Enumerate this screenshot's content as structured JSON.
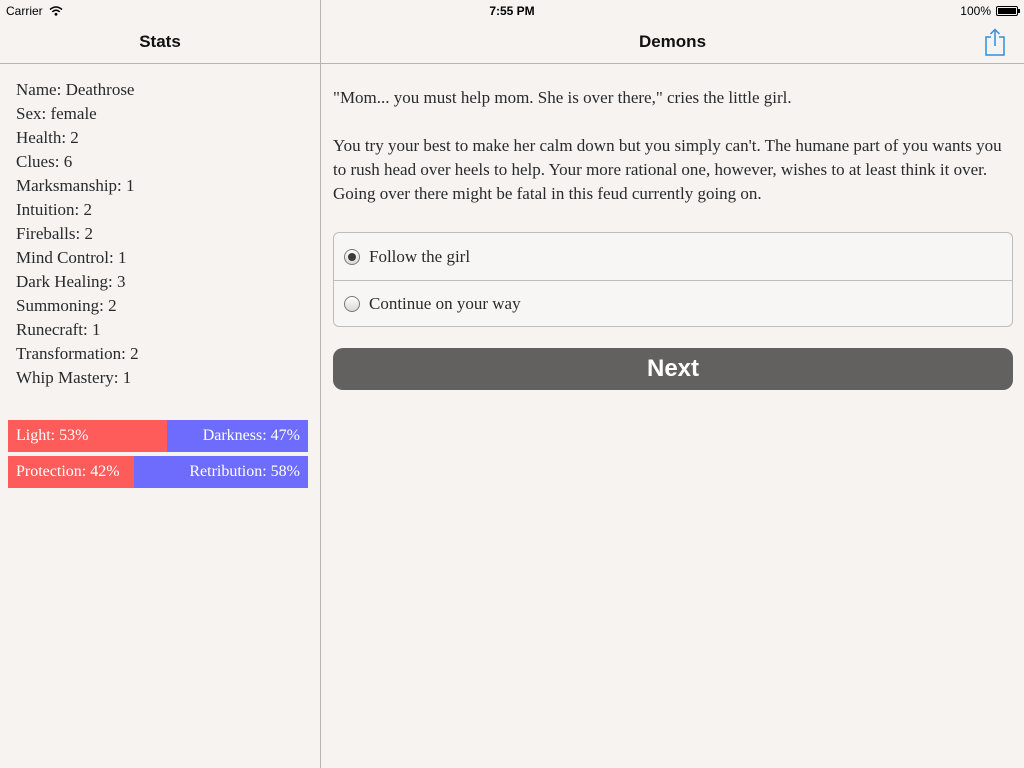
{
  "status_bar": {
    "carrier": "Carrier",
    "time": "7:55 PM",
    "battery": "100%"
  },
  "stats_panel": {
    "title": "Stats",
    "items": [
      "Name: Deathrose",
      "Sex: female",
      "Health: 2",
      "Clues: 6",
      "Marksmanship: 1",
      "Intuition: 2",
      "Fireballs: 2",
      "Mind Control: 1",
      "Dark Healing: 3",
      "Summoning: 2",
      "Runecraft: 1",
      "Transformation: 2",
      "Whip Mastery: 1"
    ],
    "bars": [
      {
        "left_label": "Light: 53%",
        "left_percent": 53,
        "right_label": "Darkness: 47%",
        "right_percent": 47
      },
      {
        "left_label": "Protection: 42%",
        "left_percent": 42,
        "right_label": "Retribution: 58%",
        "right_percent": 58
      }
    ]
  },
  "story_panel": {
    "title": "Demons",
    "share_icon": "share-icon",
    "paragraphs": [
      "\"Mom... you must help mom. She is over there,\" cries the little girl.",
      "You try your best to make her calm down but you simply can't. The humane part of you wants you to rush head over heels to help. Your more rational one, however, wishes to at least think it over. Going over there might be fatal in this feud currently going on."
    ],
    "choices": [
      {
        "label": "Follow the girl",
        "selected": true
      },
      {
        "label": "Continue on your way",
        "selected": false
      }
    ],
    "next_label": "Next"
  },
  "colors": {
    "background": "#f6f3f1",
    "light_bar": "#fe5c5a",
    "dark_bar": "#6e6cfd",
    "next_button": "#626160",
    "share_icon": "#2f8fe0"
  }
}
